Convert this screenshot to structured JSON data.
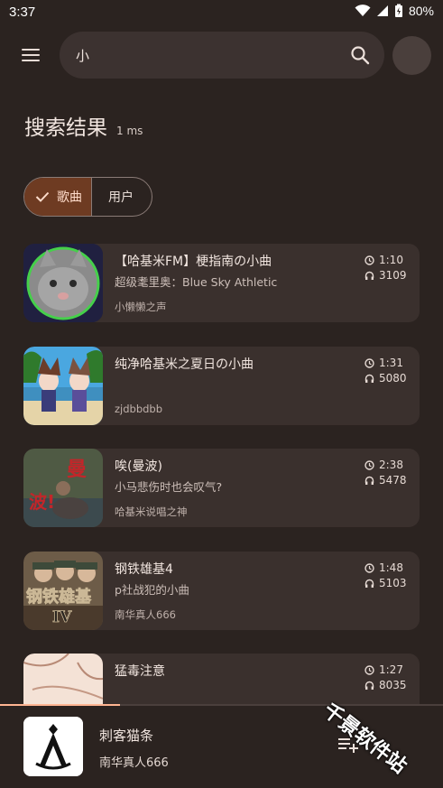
{
  "status_bar": {
    "time": "3:37",
    "battery": "80%"
  },
  "search": {
    "query": "小",
    "placeholder": ""
  },
  "results": {
    "title": "搜索结果",
    "time_taken": "1 ms"
  },
  "filters": [
    {
      "label": "歌曲",
      "selected": true
    },
    {
      "label": "用户",
      "selected": false
    }
  ],
  "songs": [
    {
      "title": "【哈基米FM】梗指南の小曲",
      "subtitle": "超级耄里奥：Blue Sky Athletic",
      "uploader": "小懒懒之声",
      "duration": "1:10",
      "plays": "3109"
    },
    {
      "title": "纯净哈基米之夏日の小曲",
      "subtitle": "",
      "uploader": "zjdbbdbb",
      "duration": "1:31",
      "plays": "5080"
    },
    {
      "title": "唉(曼波)",
      "subtitle": "小马悲伤时也会叹气?",
      "uploader": "哈基米说唱之神",
      "duration": "2:38",
      "plays": "5478"
    },
    {
      "title": "钢铁雄基4",
      "subtitle": "p社战犯的小曲",
      "uploader": "南华真人666",
      "duration": "1:48",
      "plays": "5103"
    },
    {
      "title": "猛毒注意",
      "subtitle": "",
      "uploader": "",
      "duration": "1:27",
      "plays": "8035"
    }
  ],
  "thumb_text": {
    "song3": "曼",
    "song3b": "波!",
    "song4": "钢铁雄基",
    "song4b": "IV"
  },
  "now_playing": {
    "title": "刺客猫条",
    "artist": "南华真人666",
    "progress": 0.27
  },
  "watermark": "千景软件站",
  "colors": {
    "background": "#2b2320",
    "card": "#3a302d",
    "accent": "#ffb592",
    "selected_chip": "#6e3b22"
  }
}
